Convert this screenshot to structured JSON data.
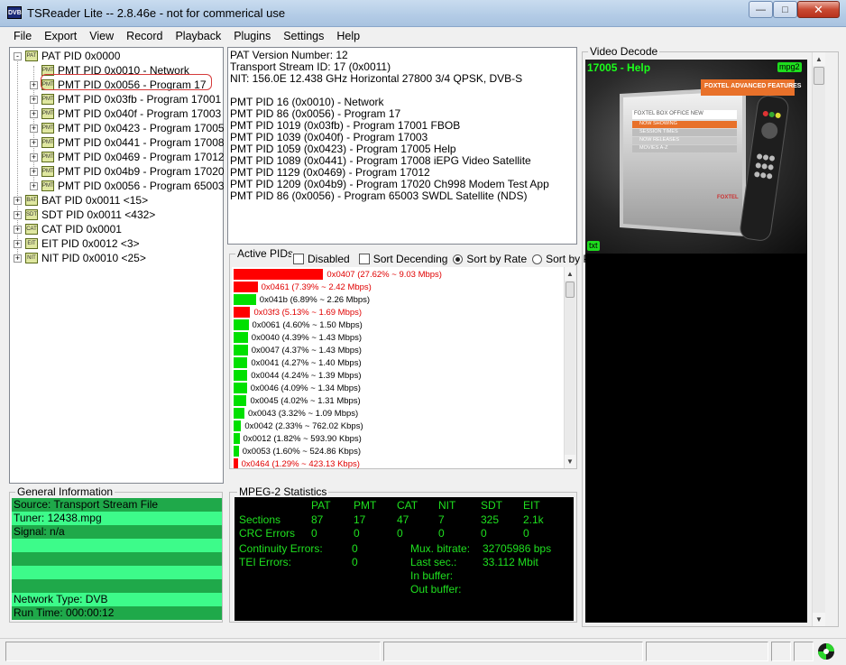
{
  "window": {
    "title": "TSReader Lite -- 2.8.46e - not for commerical use",
    "app_icon": "DVB"
  },
  "menu": [
    "File",
    "Export",
    "View",
    "Record",
    "Playback",
    "Plugins",
    "Settings",
    "Help"
  ],
  "tree": {
    "pat": "PAT PID 0x0000",
    "pmt": [
      "PMT PID 0x0010 - Network",
      "PMT PID 0x0056 - Program 17",
      "PMT PID 0x03fb - Program 17001",
      "PMT PID 0x040f - Program 17003",
      "PMT PID 0x0423 - Program 17005",
      "PMT PID 0x0441 - Program 17008",
      "PMT PID 0x0469 - Program 17012",
      "PMT PID 0x04b9 - Program 17020",
      "PMT PID 0x0056 - Program 65003"
    ],
    "others": [
      {
        "icon": "BAT",
        "label": "BAT PID 0x0011 <15>"
      },
      {
        "icon": "SDT",
        "label": "SDT PID 0x0011 <432>"
      },
      {
        "icon": "CAT",
        "label": "CAT PID 0x0001"
      },
      {
        "icon": "EIT",
        "label": "EIT PID 0x0012 <3>"
      },
      {
        "icon": "NIT",
        "label": "NIT PID 0x0010 <25>"
      }
    ],
    "icon_text": "PAT",
    "pmt_icon_text": "PMT"
  },
  "info_lines": [
    "PAT Version Number: 12",
    "Transport Stream ID: 17 (0x0011)",
    "NIT: 156.0E 12.438 GHz Horizontal 27800 3/4 QPSK, DVB-S",
    "",
    "PMT PID 16 (0x0010) - Network",
    "PMT PID 86 (0x0056) - Program 17",
    "PMT PID 1019 (0x03fb) - Program 17001 FBOB",
    "PMT PID 1039 (0x040f) - Program 17003",
    "PMT PID 1059 (0x0423) - Program 17005 Help",
    "PMT PID 1089 (0x0441) - Program 17008 iEPG Video Satellite",
    "PMT PID 1129 (0x0469) - Program 17012",
    "PMT PID 1209 (0x04b9) - Program 17020 Ch998 Modem Test App",
    "PMT PID 86 (0x0056) - Program 65003 SWDL Satellite (NDS)"
  ],
  "active_pids": {
    "label": "Active PIDs",
    "disabled": "Disabled",
    "sort_desc": "Sort Decending",
    "sort_rate": "Sort by Rate",
    "sort_pid": "Sort by PID",
    "colors": {
      "red": "#ff0000",
      "green": "#00e000"
    },
    "rows": [
      {
        "text": "0x0407 (27.62% ~ 9.03 Mbps)",
        "pct": 27.62,
        "color": "red"
      },
      {
        "text": "0x0461 (7.39% ~ 2.42 Mbps)",
        "pct": 7.39,
        "color": "red"
      },
      {
        "text": "0x041b (6.89% ~ 2.26 Mbps)",
        "pct": 6.89,
        "color": "green"
      },
      {
        "text": "0x03f3 (5.13% ~ 1.69 Mbps)",
        "pct": 5.13,
        "color": "red"
      },
      {
        "text": "0x0061 (4.60% ~ 1.50 Mbps)",
        "pct": 4.6,
        "color": "green"
      },
      {
        "text": "0x0040 (4.39% ~ 1.43 Mbps)",
        "pct": 4.39,
        "color": "green"
      },
      {
        "text": "0x0047 (4.37% ~ 1.43 Mbps)",
        "pct": 4.37,
        "color": "green"
      },
      {
        "text": "0x0041 (4.27% ~ 1.40 Mbps)",
        "pct": 4.27,
        "color": "green"
      },
      {
        "text": "0x0044 (4.24% ~ 1.39 Mbps)",
        "pct": 4.24,
        "color": "green"
      },
      {
        "text": "0x0046 (4.09% ~ 1.34 Mbps)",
        "pct": 4.09,
        "color": "green"
      },
      {
        "text": "0x0045 (4.02% ~ 1.31 Mbps)",
        "pct": 4.02,
        "color": "green"
      },
      {
        "text": "0x0043 (3.32% ~ 1.09 Mbps)",
        "pct": 3.32,
        "color": "green"
      },
      {
        "text": "0x0042 (2.33% ~ 762.02 Kbps)",
        "pct": 2.33,
        "color": "green"
      },
      {
        "text": "0x0012 (1.82% ~ 593.90 Kbps)",
        "pct": 1.82,
        "color": "green"
      },
      {
        "text": "0x0053 (1.60% ~ 524.86 Kbps)",
        "pct": 1.6,
        "color": "green"
      },
      {
        "text": "0x0464 (1.29% ~ 423.13 Kbps)",
        "pct": 1.29,
        "color": "red"
      }
    ]
  },
  "general": {
    "label": "General Information",
    "rows": [
      {
        "text": "Source: Transport Stream File",
        "shade": "dark"
      },
      {
        "text": "Tuner: 12438.mpg",
        "shade": "light"
      },
      {
        "text": "Signal: n/a",
        "shade": "dark"
      },
      {
        "text": "",
        "shade": "light"
      },
      {
        "text": "",
        "shade": "dark"
      },
      {
        "text": "",
        "shade": "light"
      },
      {
        "text": "",
        "shade": "dark"
      },
      {
        "text": "Network Type: DVB",
        "shade": "light"
      },
      {
        "text": "Run Time: 000:00:12",
        "shade": "dark"
      }
    ],
    "colors": {
      "dark": "#1fa94a",
      "light": "#3dfb8a"
    }
  },
  "mpeg": {
    "label": "MPEG-2 Statistics",
    "headers": [
      "PAT",
      "PMT",
      "CAT",
      "NIT",
      "SDT",
      "EIT"
    ],
    "sections_label": "Sections",
    "sections": [
      "87",
      "17",
      "47",
      "7",
      "325",
      "2.1k"
    ],
    "crc_label": "CRC Errors",
    "crc": [
      "0",
      "0",
      "0",
      "0",
      "0",
      "0"
    ],
    "continuity_label": "Continuity Errors:",
    "continuity": "0",
    "tei_label": "TEI Errors:",
    "tei": "0",
    "mux_label": "Mux. bitrate:",
    "mux": "32705986 bps",
    "lastsec_label": "Last sec.:",
    "lastsec": "33.112 Mbit",
    "inbuf_label": "In buffer:",
    "outbuf_label": "Out buffer:"
  },
  "video": {
    "label": "Video Decode",
    "title": "17005 - Help",
    "badge_codec": "mpg2",
    "badge_txt": "txt",
    "banner": "FOXTEL ADVANCED FEATURES",
    "menu_head": "FOXTEL BOX OFFICE NEW",
    "menu_items": [
      "NOW SHOWING",
      "SESSION TIMES",
      "NOW RELEASES",
      "MOVIES A-Z"
    ],
    "brand": "FOXTEL"
  }
}
